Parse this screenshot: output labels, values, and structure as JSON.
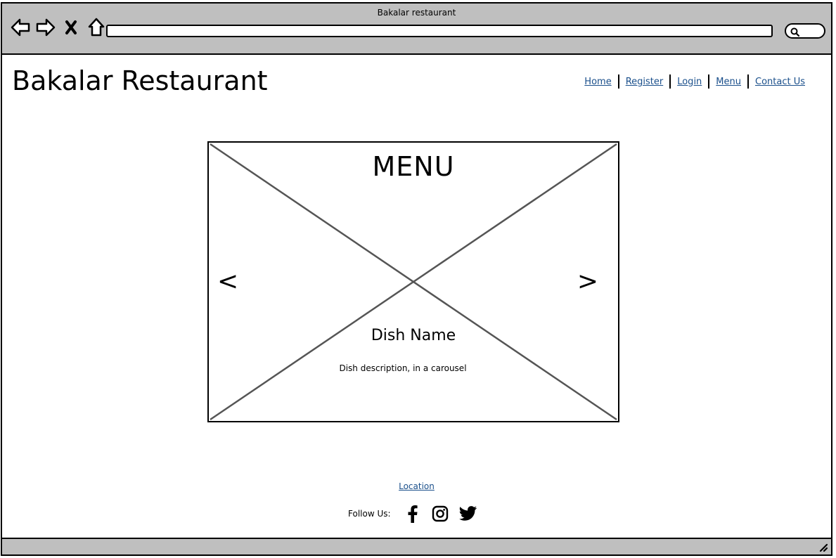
{
  "window": {
    "title": "Bakalar restaurant"
  },
  "browser": {
    "nav_icons": [
      "back-arrow-icon",
      "forward-arrow-icon",
      "close-icon",
      "home-icon"
    ],
    "search_icon": "search-icon"
  },
  "site": {
    "title": "Bakalar Restaurant"
  },
  "nav": {
    "items": [
      {
        "label": "Home"
      },
      {
        "label": "Register"
      },
      {
        "label": "Login"
      },
      {
        "label": "Menu"
      },
      {
        "label": "Contact Us"
      }
    ],
    "link_color": "#1a4f8b"
  },
  "carousel": {
    "heading": "MENU",
    "prev_label": "<",
    "next_label": ">",
    "dish_name": "Dish Name",
    "dish_description": "Dish description, in a carousel"
  },
  "footer": {
    "location_link": "Location",
    "follow_label": "Follow Us:",
    "social_icons": [
      "facebook-icon",
      "instagram-icon",
      "twitter-icon"
    ]
  },
  "colors": {
    "chrome": "#bfbfbf",
    "link": "#1a4f8b"
  }
}
